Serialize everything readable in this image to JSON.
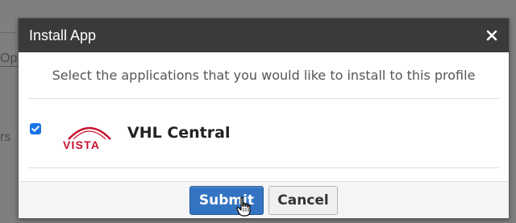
{
  "background": {
    "fragment_top": "Op",
    "fragment_mid": "rs"
  },
  "dialog": {
    "title": "Install App",
    "close_glyph": "✕",
    "instructions": "Select the applications that you would like to install to this profile"
  },
  "apps": [
    {
      "name": "VHL Central",
      "logo_text": "VISTA",
      "checked": true,
      "icon": "vista-logo-icon"
    }
  ],
  "footer": {
    "submit_label": "Submit",
    "cancel_label": "Cancel"
  },
  "colors": {
    "header_bg": "#3a3a3a",
    "submit_bg": "#3274c1",
    "checkbox": "#1a73e8",
    "vista_red": "#c8102e"
  }
}
